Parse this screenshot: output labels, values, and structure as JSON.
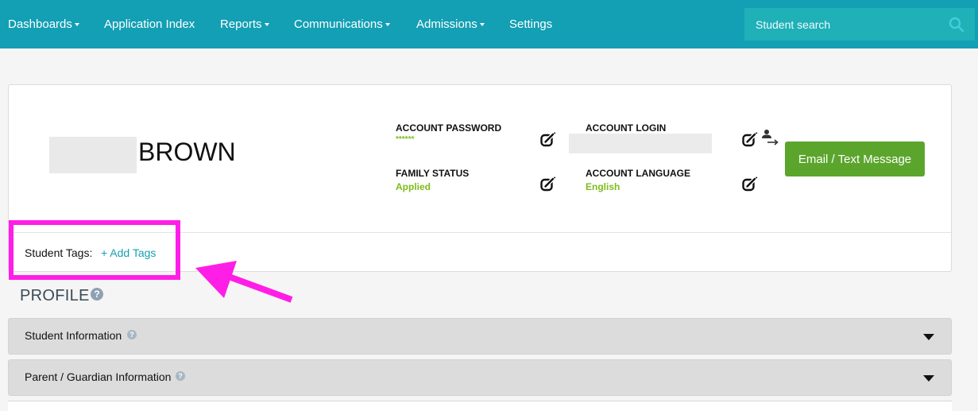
{
  "nav": {
    "items": [
      {
        "label": "Dashboards",
        "dropdown": true
      },
      {
        "label": "Application Index",
        "dropdown": false
      },
      {
        "label": "Reports",
        "dropdown": true
      },
      {
        "label": "Communications",
        "dropdown": true
      },
      {
        "label": "Admissions",
        "dropdown": true
      },
      {
        "label": "Settings",
        "dropdown": false
      }
    ],
    "search": {
      "placeholder": "Student search",
      "value": ""
    }
  },
  "student": {
    "first_name": "",
    "last_name": "BROWN"
  },
  "account": {
    "password_label": "ACCOUNT PASSWORD",
    "password_value": "******",
    "login_label": "ACCOUNT LOGIN",
    "login_value": "",
    "family_status_label": "FAMILY STATUS",
    "family_status_value": "Applied",
    "language_label": "ACCOUNT LANGUAGE",
    "language_value": "English"
  },
  "actions": {
    "email_button": "Email / Text Message"
  },
  "tags": {
    "label": "Student Tags:",
    "add_link": "+ Add Tags"
  },
  "profile": {
    "title": "PROFILE",
    "help_glyph": "?",
    "sections": [
      {
        "label": "Student Information"
      },
      {
        "label": "Parent / Guardian Information"
      }
    ]
  },
  "colors": {
    "nav_bg": "#139fb4",
    "accent": "#159fb4",
    "status_green": "#7cbd1c",
    "button_green": "#5ca52d",
    "annotation_magenta": "#ff1ee6"
  },
  "icons": {
    "search": "search-icon",
    "edit": "edit-icon",
    "switch_user": "switch-user-icon",
    "help": "help-icon",
    "expand": "caret-down-icon"
  }
}
